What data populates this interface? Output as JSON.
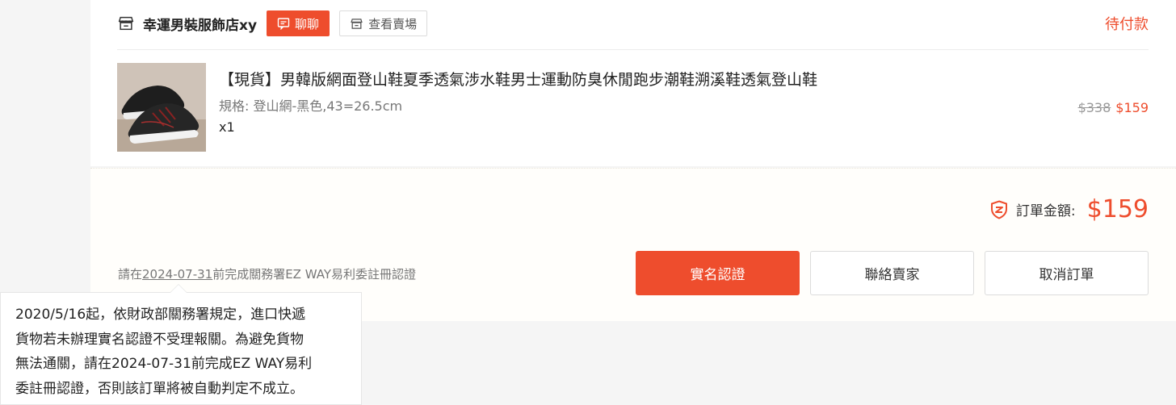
{
  "shop": {
    "name": "幸運男裝服飾店xy",
    "chat_label": "聊聊",
    "view_shop_label": "查看賣場",
    "order_status": "待付款",
    "icon": "store-icon"
  },
  "product": {
    "title": "【現貨】男韓版網面登山鞋夏季透氣涉水鞋男士運動防臭休閒跑步潮鞋溯溪鞋透氣登山鞋",
    "spec": "規格: 登山網-黑色,43=26.5cm",
    "quantity": "x1",
    "original_price": "$338",
    "price": "$159"
  },
  "summary": {
    "total_label": "訂單金額:",
    "total_amount": "$159",
    "notice_prefix": "請在",
    "notice_date": "2024-07-31",
    "notice_suffix": "前完成關務署EZ WAY易利委註冊認證",
    "verify_button": "實名認證",
    "contact_button": "聯絡賣家",
    "cancel_button": "取消訂單"
  },
  "tooltip": {
    "lines": [
      "2020/5/16起，依財政部關務署規定，進口快遞",
      "貨物若未辦理實名認證不受理報關。為避免貨物",
      "無法通關，請在2024-07-31前完成EZ WAY易利",
      "委註冊認證，否則該訂單將被自動判定不成立。"
    ]
  },
  "colors": {
    "accent": "#ee4d2d",
    "page_bg": "#f5f5f5",
    "summary_bg": "#fffefb"
  }
}
